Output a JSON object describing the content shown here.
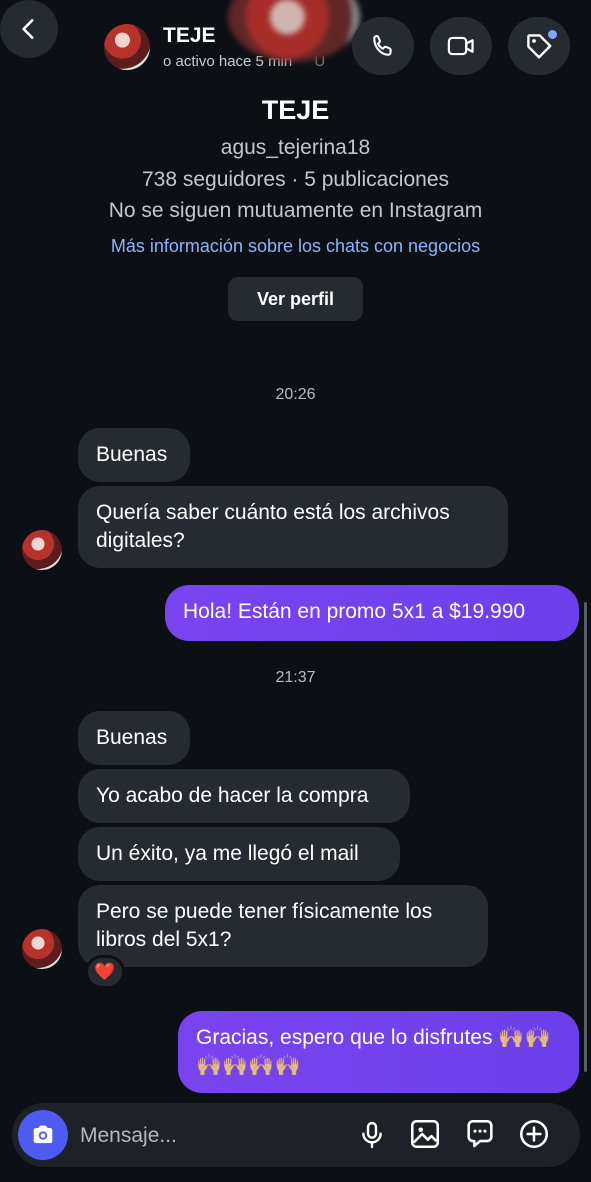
{
  "header": {
    "contact_name": "TEJE",
    "status": "o activo hace 5 min",
    "status_trail": "U"
  },
  "profile": {
    "name": "TEJE",
    "username": "agus_tejerina18",
    "stats": "738 seguidores · 5 publicaciones",
    "mutual": "No se siguen mutuamente en Instagram",
    "business_link": "Más información sobre los chats con negocios",
    "view_profile": "Ver perfil"
  },
  "thread": {
    "time1": "20:26",
    "m1": "Buenas",
    "m2": "Quería saber cuánto está los archivos digitales?",
    "m3": "Hola!  Están en promo 5x1 a $19.990",
    "time2": "21:37",
    "m4": "Buenas",
    "m5": "Yo acabo de hacer la compra",
    "m6": "Un éxito, ya me llegó el mail",
    "m7": "Pero se puede tener físicamente los libros del 5x1?",
    "reaction": "❤️",
    "m8": "Gracias, espero que lo disfrutes 🙌🏼🙌🏼🙌🏼🙌🏼🙌🏼🙌🏼"
  },
  "composer": {
    "placeholder": "Mensaje..."
  },
  "colors": {
    "background": "#0c0f14",
    "incoming_bubble": "#262a31",
    "outgoing_bubble": "#7443ee",
    "link": "#8ab4ff",
    "camera_button": "#4f5bf0"
  },
  "icons": [
    "back-icon",
    "phone-icon",
    "video-camera-icon",
    "tag-icon",
    "camera-icon",
    "microphone-icon",
    "gallery-icon",
    "sticker-chat-icon",
    "plus-icon"
  ]
}
